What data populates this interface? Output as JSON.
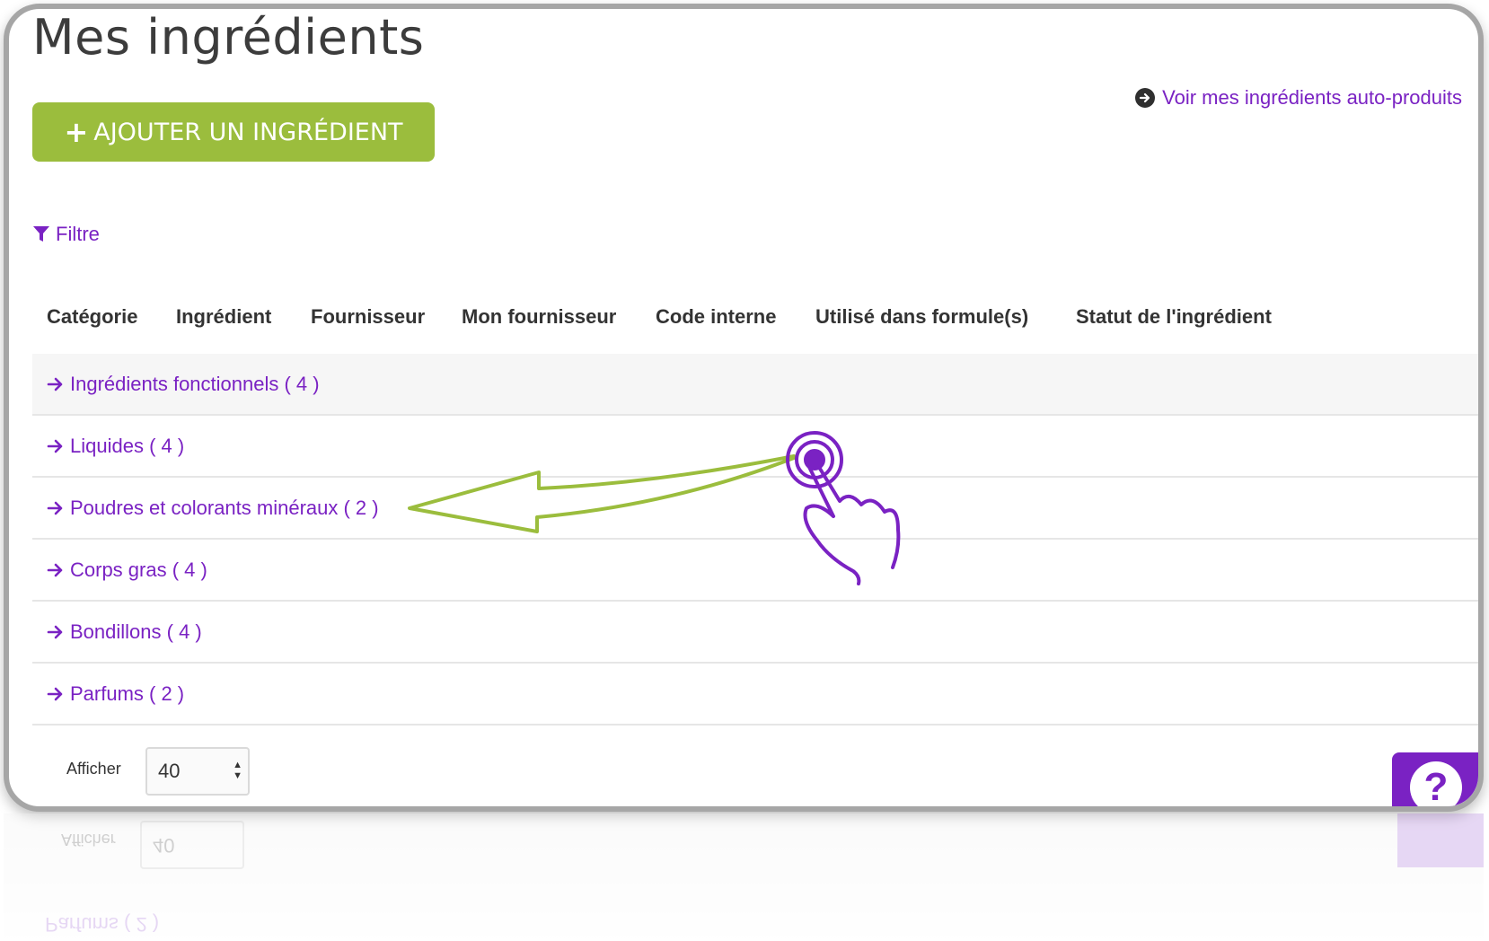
{
  "page": {
    "title": "Mes ingrédients"
  },
  "actions": {
    "add_ingredient_label": "AJOUTER UN INGRÉDIENT",
    "auto_products_link": "Voir mes ingrédients auto-produits",
    "filter_label": "Filtre"
  },
  "table": {
    "columns": [
      "Catégorie",
      "Ingrédient",
      "Fournisseur",
      "Mon fournisseur",
      "Code interne",
      "Utilisé dans formule(s)",
      "Statut de l'ingrédient"
    ],
    "rows": [
      {
        "label": "Ingrédients fonctionnels ( 4 )"
      },
      {
        "label": "Liquides ( 4 )"
      },
      {
        "label": "Poudres et colorants minéraux ( 2 )"
      },
      {
        "label": "Corps gras ( 4 )"
      },
      {
        "label": "Bondillons ( 4 )"
      },
      {
        "label": "Parfums ( 2 )"
      }
    ]
  },
  "pagination": {
    "show_label": "Afficher",
    "page_size": "40"
  },
  "help": {
    "symbol": "?"
  },
  "colors": {
    "accent": "#7a22c3",
    "button_green": "#9bbd3d",
    "annotation_arrow": "#9bbd3d"
  },
  "icons": {
    "add": "plus-icon",
    "auto_link": "circle-arrow-right-icon",
    "filter": "funnel-icon",
    "row": "arrow-right-icon",
    "annotation": "tap-hand-icon"
  }
}
